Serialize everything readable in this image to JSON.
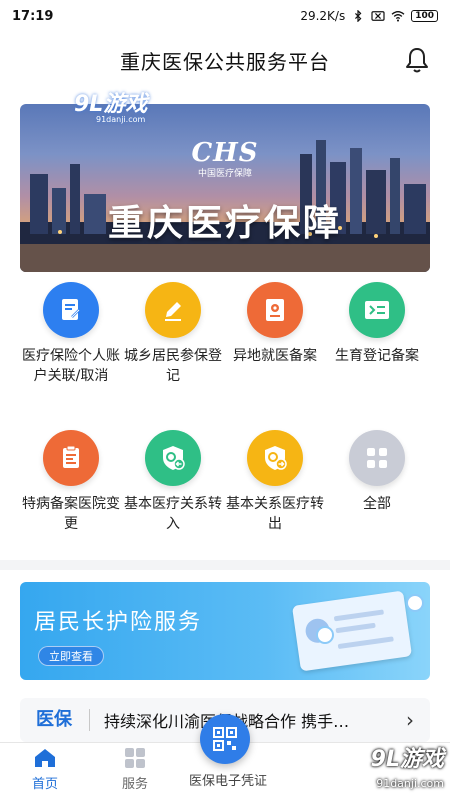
{
  "status_bar": {
    "time": "17:19",
    "speed": "29.2K/s",
    "battery": "100",
    "icons": [
      "bluetooth-icon",
      "sim-off-icon",
      "wifi-icon",
      "battery-icon"
    ]
  },
  "header": {
    "title": "重庆医保公共服务平台",
    "icon": "bell-icon"
  },
  "banner": {
    "logo": "CHS",
    "logo_sub": "中国医疗保障",
    "title": "重庆医疗保障",
    "watermark": "9L游戏",
    "watermark_url": "91danji.com"
  },
  "grid": {
    "items": [
      {
        "label": "医疗保险个人账户关联/取消",
        "icon": "document-link-icon",
        "color": "#2d7ff0"
      },
      {
        "label": "城乡居民参保登记",
        "icon": "edit-pencil-icon",
        "color": "#f6b514"
      },
      {
        "label": "异地就医备案",
        "icon": "location-card-icon",
        "color": "#ee6a37"
      },
      {
        "label": "生育登记备案",
        "icon": "id-card-icon",
        "color": "#2fbf86"
      },
      {
        "label": "特病备案医院变更",
        "icon": "clipboard-edit-icon",
        "color": "#ee6a37"
      },
      {
        "label": "基本医疗关系转入",
        "icon": "shield-transfer-in-icon",
        "color": "#2fbf86"
      },
      {
        "label": "基本关系医疗转出",
        "icon": "shield-transfer-out-icon",
        "color": "#f6b514"
      },
      {
        "label": "全部",
        "icon": "grid-all-icon",
        "color": "#c9ccd6"
      }
    ]
  },
  "promo": {
    "title": "居民长护险服务",
    "button": "立即查看"
  },
  "news": {
    "tag": "医保",
    "text": "持续深化川渝医保战略合作 携手…"
  },
  "bottom_nav": {
    "home": "首页",
    "service": "服务",
    "code": "医保电子凭证"
  },
  "brand_watermark": {
    "name": "9L游戏",
    "url": "91danji.com"
  },
  "colors": {
    "accent": "#2f7de8",
    "nav_active": "#1f6fd8"
  }
}
